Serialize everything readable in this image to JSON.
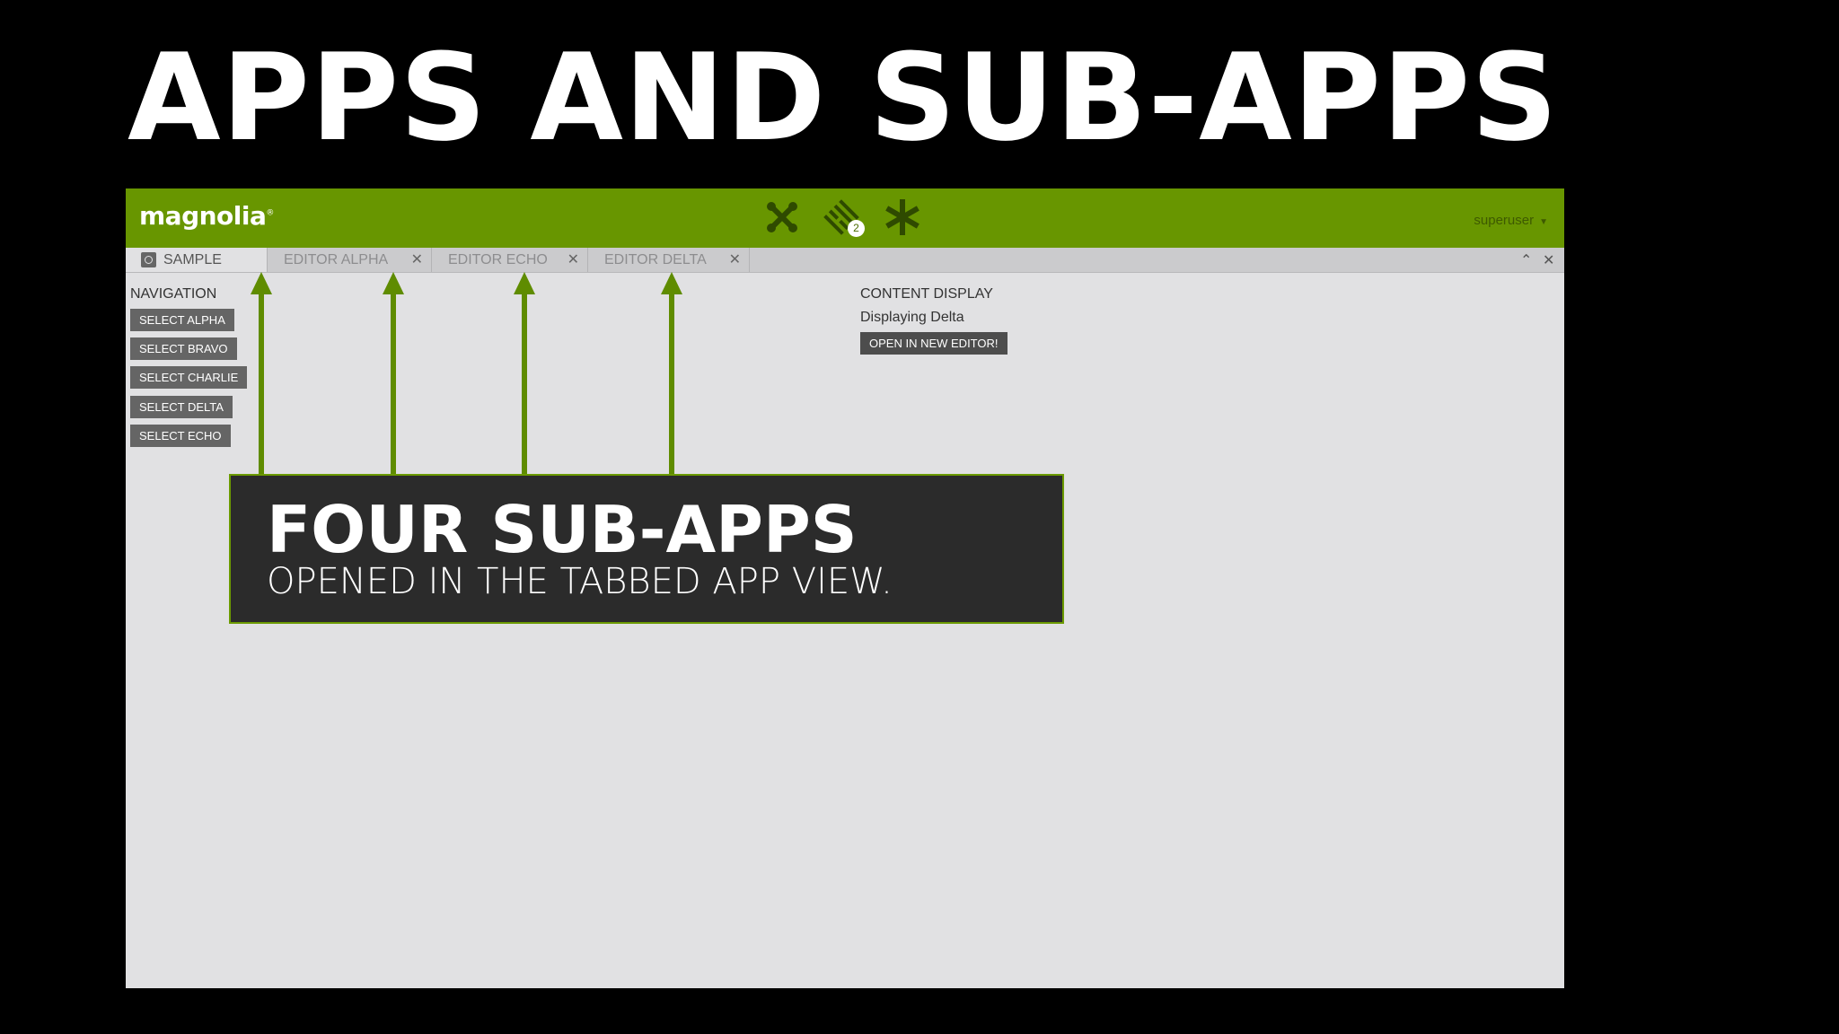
{
  "slide": {
    "title": "APPS AND SUB-APPS"
  },
  "shell": {
    "logo": "magnolia",
    "logo_mark": "®",
    "icons": [
      "app-launcher-icon",
      "pulse-icon",
      "favorites-icon"
    ],
    "pulse_badge": "2",
    "user": "superuser",
    "user_caret": "▼",
    "brand_color": "#689600"
  },
  "tabs": [
    {
      "label": "SAMPLE",
      "active": true,
      "icon": "app-icon"
    },
    {
      "label": "EDITOR ALPHA",
      "close": "✕"
    },
    {
      "label": "EDITOR ECHO",
      "close": "✕"
    },
    {
      "label": "EDITOR DELTA",
      "close": "✕"
    }
  ],
  "window_controls": {
    "fullscreen": "⌃",
    "close": "✕"
  },
  "navigation": {
    "title": "NAVIGATION",
    "buttons": [
      "SELECT ALPHA",
      "SELECT BRAVO",
      "SELECT CHARLIE",
      "SELECT DELTA",
      "SELECT ECHO"
    ]
  },
  "content": {
    "title": "CONTENT DISPLAY",
    "text": "Displaying Delta",
    "button": "OPEN IN NEW EDITOR!"
  },
  "callout": {
    "title": "FOUR SUB-APPS",
    "subtitle": "OPENED IN THE TABBED APP VIEW."
  },
  "annotation_color": "#5f8c00"
}
